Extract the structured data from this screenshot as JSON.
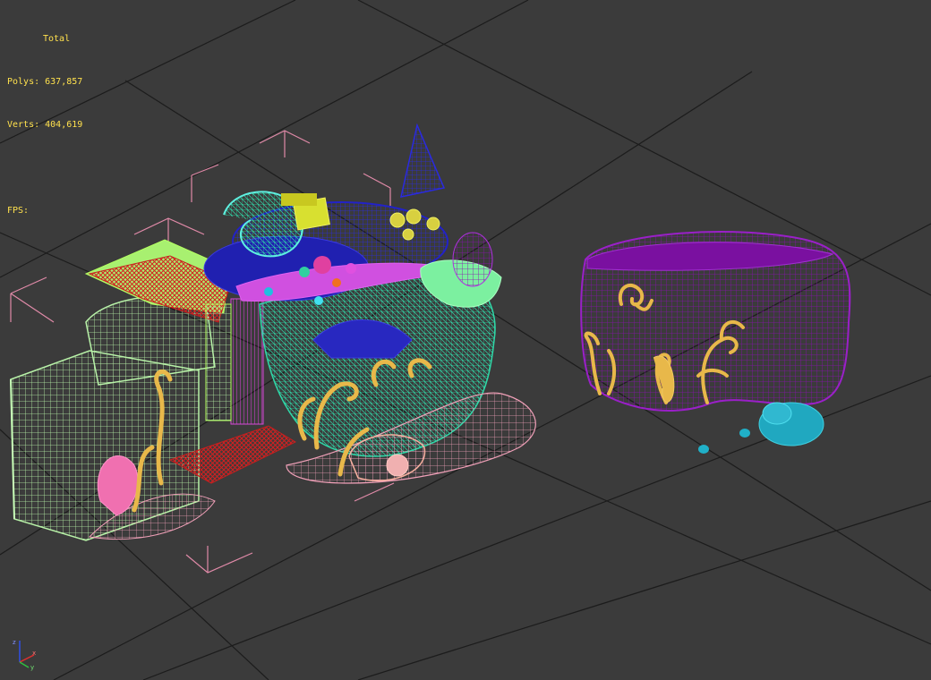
{
  "stats": {
    "title": "Total",
    "polys": "Polys: 637,857",
    "verts": "Verts: 404,619",
    "fps": "FPS:"
  },
  "axis_labels": {
    "x": "x",
    "y": "y",
    "z": "z"
  },
  "colors": {
    "background": "#3b3b3b",
    "grid": "#1e1e1e",
    "stats_text": "#ffe14d",
    "bracket": "#e08aa8",
    "mint": "#b8f2a8",
    "lime": "#b4ff60",
    "red": "#c81e1e",
    "magenta": "#d84ad8",
    "teal": "#2fd8a8",
    "blue": "#2222c8",
    "purple": "#8a10b0",
    "gold": "#e8b84a",
    "pink": "#f0a0b8",
    "cyan": "#20b8c8"
  }
}
